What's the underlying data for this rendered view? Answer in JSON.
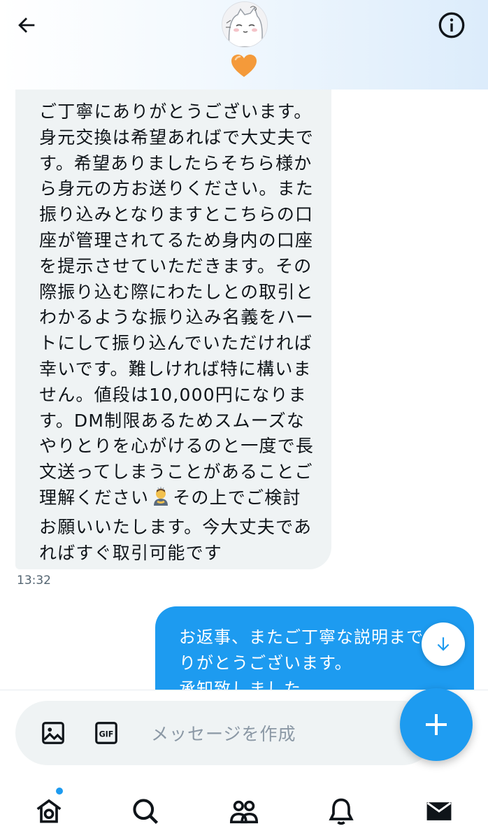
{
  "colors": {
    "accent": "#1d9bf0",
    "incoming_bubble": "#eff3f4",
    "text": "#0f1419",
    "muted": "#536471"
  },
  "header": {
    "back_icon": "arrow-left-icon",
    "info_icon": "info-icon",
    "avatar_icon": "cat-avatar",
    "heart_icon": "orange-heart-icon"
  },
  "messages": {
    "incoming": {
      "lines": [
        "ご丁寧にありがとうございます。",
        "身元交換は希望あればで大丈夫で",
        "す。希望ありましたらそちら様か",
        "ら身元の方お送りください。また",
        "振り込みとなりますとこちらの口",
        "座が管理されてるため身内の口座",
        "を提示させていただきます。その",
        "際振り込む際にわたしとの取引と",
        "わかるような振り込み名義をハー",
        "トにして振り込んでいただければ",
        "幸いです。難しければ特に構いま",
        "せん。値段は10,000円になりま",
        "す。DM制限あるためスムーズな",
        "やりとりを心がけるのと一度で長",
        "文送ってしまうことがあることご",
        "理解ください",
        "その上でご検討",
        "お願いいたします。今大丈夫であ",
        "ればすぐ取引可能です"
      ],
      "emoji": "bowing-person-emoji",
      "time": "13:32"
    },
    "outgoing": {
      "lines": [
        "お返事、またご丁寧な説明まで",
        "りがとうございます。",
        "承知致しました。"
      ]
    }
  },
  "scroll_down_icon": "arrow-down-icon",
  "composer": {
    "placeholder": "メッセージを作成",
    "value": "",
    "image_icon": "image-icon",
    "gif_label": "GIF",
    "fab_icon": "plus-icon"
  },
  "nav": {
    "items": [
      "home-icon",
      "search-icon",
      "communities-icon",
      "notifications-icon",
      "messages-icon"
    ],
    "home_has_dot": true
  }
}
